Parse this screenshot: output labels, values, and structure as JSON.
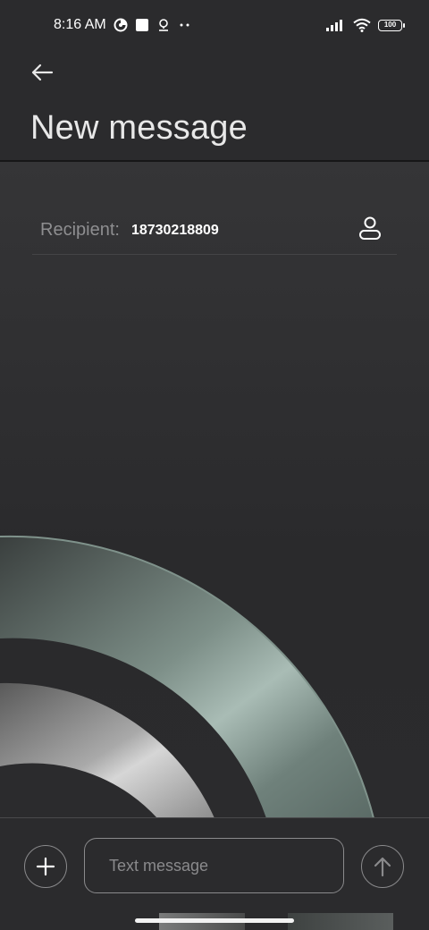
{
  "status_bar": {
    "time": "8:16 AM",
    "notification_icons": [
      "data-saver-icon",
      "square-notification-icon",
      "location-pin-icon",
      "more-dots-icon"
    ],
    "system_icons": [
      "signal-bars-icon",
      "wifi-icon",
      "battery-icon"
    ],
    "battery_level": "100"
  },
  "header": {
    "back_icon": "arrow-left-icon",
    "title": "New message"
  },
  "recipient": {
    "label": "Recipient:",
    "value": "18730218809",
    "contact_icon": "person-icon"
  },
  "compose": {
    "attach_icon": "plus-icon",
    "placeholder": "Text message",
    "value": "",
    "send_icon": "arrow-up-icon"
  },
  "colors": {
    "background": "#2b2b2d",
    "divider": "#161617",
    "muted_text": "#8e8e90",
    "outline": "#8a8a8c",
    "wallpaper_green": "#9aaea6",
    "wallpaper_silver": "#c9c9c9"
  }
}
